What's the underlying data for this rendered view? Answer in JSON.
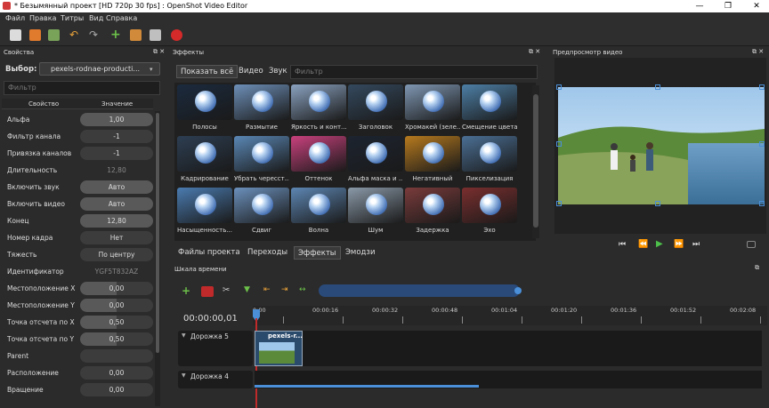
{
  "window": {
    "title": "* Безымянный проект [HD 720p 30 fps] : OpenShot Video Editor",
    "minimize": "—",
    "maximize": "❐",
    "close": "✕"
  },
  "menu": [
    "Файл",
    "Правка",
    "Титры",
    "Вид",
    "Справка"
  ],
  "toolbar": [
    "new-project-icon",
    "open-project-icon",
    "save-project-icon",
    "undo-icon",
    "redo-icon",
    "import-files-icon",
    "choose-profile-icon",
    "fullscreen-icon",
    "export-video-icon"
  ],
  "properties": {
    "title": "Свойства",
    "selection_label": "Выбор:",
    "selection_value": "pexels-rodnae-producti...",
    "filter_placeholder": "Фильтр",
    "col_property": "Свойство",
    "col_value": "Значение",
    "rows": [
      {
        "name": "Альфа",
        "value": "1,00",
        "style": "full"
      },
      {
        "name": "Фильтр канала",
        "value": "-1",
        "style": "plain"
      },
      {
        "name": "Привязка каналов",
        "value": "-1",
        "style": "plain"
      },
      {
        "name": "Длительность",
        "value": "12,80",
        "style": "dim"
      },
      {
        "name": "Включить звук",
        "value": "Авто",
        "style": "full"
      },
      {
        "name": "Включить видео",
        "value": "Авто",
        "style": "full"
      },
      {
        "name": "Конец",
        "value": "12,80",
        "style": "full"
      },
      {
        "name": "Номер кадра",
        "value": "Нет",
        "style": "plain"
      },
      {
        "name": "Тяжесть",
        "value": "По центру",
        "style": "plain"
      },
      {
        "name": "Идентификатор",
        "value": "YGF5T832AZ",
        "style": "dim"
      },
      {
        "name": "Местоположение X",
        "value": "0,00",
        "style": "half"
      },
      {
        "name": "Местоположение Y",
        "value": "0,00",
        "style": "half"
      },
      {
        "name": "Точка отсчета по X",
        "value": "0,50",
        "style": "half"
      },
      {
        "name": "Точка отсчета по Y",
        "value": "0,50",
        "style": "half"
      },
      {
        "name": "Parent",
        "value": "",
        "style": "plain"
      },
      {
        "name": "Расположение",
        "value": "0,00",
        "style": "plain"
      },
      {
        "name": "Вращение",
        "value": "0,00",
        "style": "plain"
      }
    ]
  },
  "effects": {
    "title": "Эффекты",
    "tabs": [
      "Показать всё",
      "Видео",
      "Звук"
    ],
    "filter_placeholder": "Фильтр",
    "items": [
      {
        "label": "Полосы",
        "color": "#1b2a3e"
      },
      {
        "label": "Размытие",
        "color": "#6d8fb8"
      },
      {
        "label": "Яркость и конт...",
        "color": "#8aa2c0"
      },
      {
        "label": "Заголовок",
        "color": "#34495e"
      },
      {
        "label": "Хромакей (зеле...",
        "color": "#7f97b3"
      },
      {
        "label": "Смещение цвета",
        "color": "#4d7fa6"
      },
      {
        "label": "Кадрирование",
        "color": "#2d3e52"
      },
      {
        "label": "Убрать чересст...",
        "color": "#5a87b5"
      },
      {
        "label": "Оттенок",
        "color": "#c9417d"
      },
      {
        "label": "Альфа маска и ...",
        "color": "#1d2430"
      },
      {
        "label": "Негативный",
        "color": "#b77a1e"
      },
      {
        "label": "Пикселизация",
        "color": "#4b6f94"
      },
      {
        "label": "Насыщенность...",
        "color": "#4a7bb0"
      },
      {
        "label": "Сдвиг",
        "color": "#6b90bc"
      },
      {
        "label": "Волна",
        "color": "#5d86b3"
      },
      {
        "label": "Шум",
        "color": "#8a99a8"
      },
      {
        "label": "Задержка",
        "color": "#7a3b3b"
      },
      {
        "label": "Эхо",
        "color": "#7a2e2e"
      }
    ]
  },
  "dock_tabs": [
    "Файлы проекта",
    "Переходы",
    "Эффекты",
    "Эмодзи"
  ],
  "preview": {
    "title": "Предпросмотр видео",
    "controls": [
      "jump-start-icon",
      "rewind-icon",
      "play-icon",
      "fast-forward-icon",
      "jump-end-icon"
    ]
  },
  "timeline": {
    "title": "Шкала времени",
    "timecode": "00:00:00,01",
    "ruler": [
      "0:00",
      "00:00:16",
      "00:00:32",
      "00:00:48",
      "00:01:04",
      "00:01:20",
      "00:01:36",
      "00:01:52",
      "00:02:08"
    ],
    "tracks": [
      {
        "name": "Дорожка 5",
        "clip": "pexels-r..."
      },
      {
        "name": "Дорожка 4",
        "clip": ""
      }
    ]
  }
}
